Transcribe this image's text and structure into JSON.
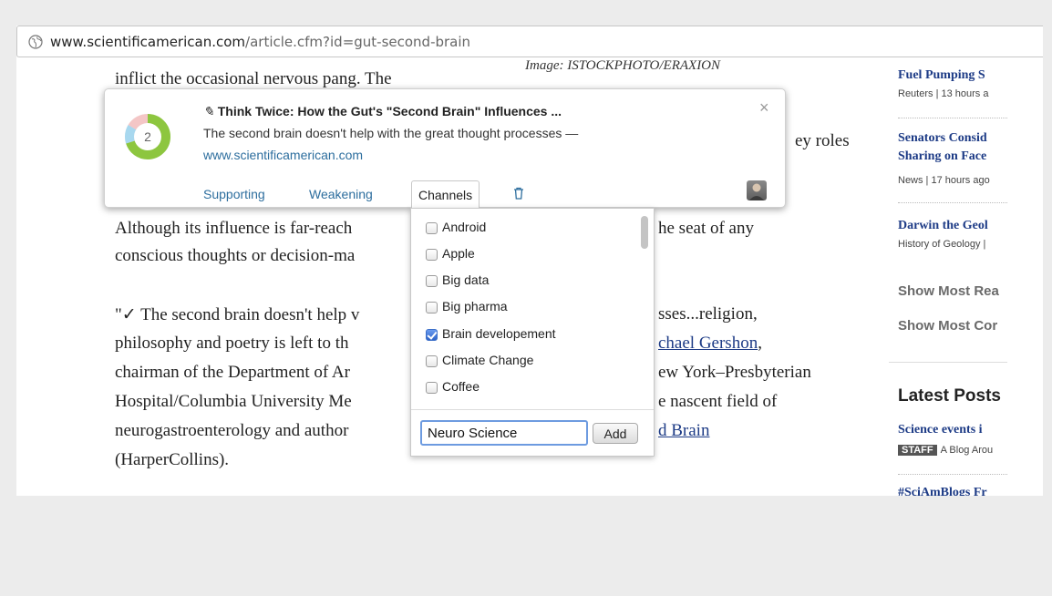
{
  "browser": {
    "url_domain": "www.scientificamerican.com",
    "url_path": "/article.cfm?id=gut-second-brain"
  },
  "article": {
    "caption": "Image: ISTOCKPHOTO/ERAXION",
    "line_top": "inflict the occasional nervous pang. The",
    "line_roles": "ey roles",
    "p2_line1": "Although its influence is far-reach",
    "p2_line1_end": "he seat of any",
    "p2_line2": "conscious thoughts or decision-ma",
    "q_line1": "\"✓ The second brain doesn't help v",
    "q_line1_end": "sses...religion,",
    "q_line2": "philosophy and poetry is left to th",
    "q_line2_link": "chael Gershon",
    "q_line2_end": ",",
    "q_line3": "chairman of the Department of Ar",
    "q_line3_end": "ew York–Presbyterian",
    "q_line4": "Hospital/Columbia University Me",
    "q_line4_end": "e nascent field of",
    "q_line5": "neurogastroenterology and author",
    "q_line5_link": "d Brain",
    "q_line6": "(HarperCollins)."
  },
  "sidebar": {
    "items": [
      {
        "title": "Fuel Pumping S",
        "meta": "Reuters | 13 hours a"
      },
      {
        "title": "Senators Consid",
        "title2": "Sharing on Face",
        "meta": "News | 17 hours ago"
      },
      {
        "title": "Darwin the Geol",
        "meta": "History of Geology |"
      }
    ],
    "show_most_read": "Show Most Rea",
    "show_most_commented": "Show Most Cor",
    "latest_heading": "Latest Posts",
    "latest_items": [
      {
        "title": "Science events i",
        "badge": "STAFF",
        "meta": "A Blog Arou"
      },
      {
        "title": "#SciAmBlogs Fr"
      }
    ]
  },
  "card": {
    "title": "Think Twice: How the Gut's \"Second Brain\" Influences ...",
    "description": "The second brain doesn't help with the great thought processes —",
    "source": "www.scientificamerican.com",
    "count": "2",
    "close": "×",
    "tabs": {
      "supporting": "Supporting",
      "weakening": "Weakening",
      "channels": "Channels"
    },
    "colors": {
      "green": "#8dc63f",
      "blue": "#a8d8ef",
      "pink": "#f4c6c6",
      "link": "#2d6e9e"
    }
  },
  "channels": {
    "items": [
      {
        "label": "Android",
        "checked": false
      },
      {
        "label": "Apple",
        "checked": false
      },
      {
        "label": "Big data",
        "checked": false
      },
      {
        "label": "Big pharma",
        "checked": false
      },
      {
        "label": "Brain developement",
        "checked": true
      },
      {
        "label": "Climate Change",
        "checked": false
      },
      {
        "label": "Coffee",
        "checked": false
      }
    ],
    "input_value": "Neuro Science",
    "add_label": "Add"
  }
}
